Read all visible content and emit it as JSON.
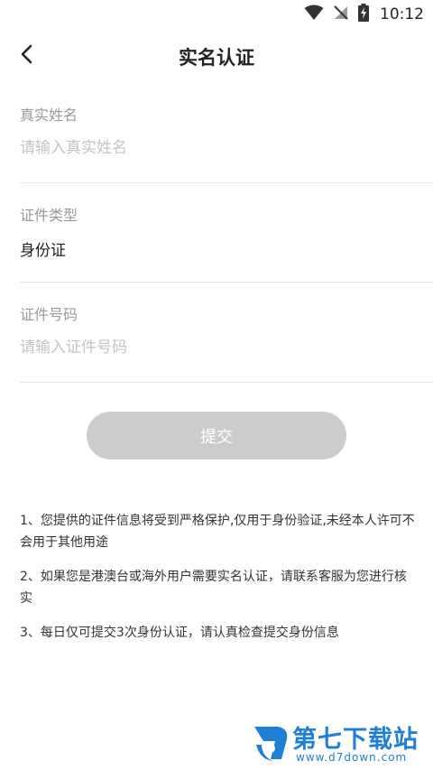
{
  "status_bar": {
    "time": "10:12",
    "icons": [
      "wifi-icon",
      "no-signal-icon",
      "battery-charging-icon"
    ]
  },
  "header": {
    "back_icon": "chevron-left-icon",
    "title": "实名认证"
  },
  "form": {
    "name": {
      "label": "真实姓名",
      "placeholder": "请输入真实姓名",
      "value": ""
    },
    "id_type": {
      "label": "证件类型",
      "value": "身份证"
    },
    "id_number": {
      "label": "证件号码",
      "placeholder": "请输入证件号码",
      "value": ""
    }
  },
  "submit": {
    "label": "提交",
    "color": "#cccccc"
  },
  "notes": [
    "1、您提供的证件信息将受到严格保护,仅用于身份验证,未经本人许可不会用于其他用途",
    "2、如果您是港澳台或海外用户需要实名认证，请联系客服为您进行核实",
    "3、每日仅可提交3次身份认证，请认真检查提交身份信息"
  ],
  "watermark": {
    "logo_icon": "d7-logo-icon",
    "text": "第七下载站",
    "url": "www.d7down.com",
    "color": "#1f7fd6"
  }
}
